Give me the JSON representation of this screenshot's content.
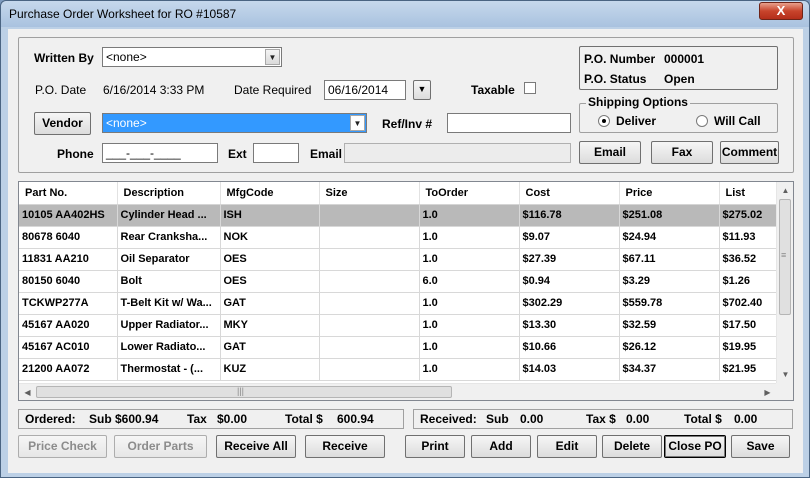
{
  "window": {
    "title": "Purchase Order Worksheet for RO #10587",
    "close_glyph": "X"
  },
  "form": {
    "written_by_label": "Written By",
    "written_by_value": "<none>",
    "po_date_label": "P.O. Date",
    "po_date_value": "6/16/2014 3:33 PM",
    "date_required_label": "Date Required",
    "date_required_value": "06/16/2014",
    "taxable_label": "Taxable",
    "vendor_button": "Vendor",
    "vendor_value": "<none>",
    "refinv_label": "Ref/Inv #",
    "refinv_value": "",
    "phone_label": "Phone",
    "phone_value": "___-___-____",
    "ext_label": "Ext",
    "ext_value": "",
    "email_label": "Email",
    "email_value": ""
  },
  "po_info": {
    "number_label": "P.O. Number",
    "number_value": "000001",
    "status_label": "P.O. Status",
    "status_value": "Open"
  },
  "shipping": {
    "title": "Shipping Options",
    "deliver_label": "Deliver",
    "willcall_label": "Will Call",
    "selected": "Deliver"
  },
  "contact_buttons": {
    "email": "Email",
    "fax": "Fax",
    "comment": "Comment"
  },
  "grid": {
    "columns": [
      "Part No.",
      "Description",
      "MfgCode",
      "Size",
      "ToOrder",
      "Cost",
      "Price",
      "List"
    ],
    "rows": [
      [
        "10105 AA402HS",
        "Cylinder Head ...",
        "ISH",
        "",
        "1.0",
        "$116.78",
        "$251.08",
        "$275.02"
      ],
      [
        "80678 6040",
        "Rear Cranksha...",
        "NOK",
        "",
        "1.0",
        "$9.07",
        "$24.94",
        "$11.93"
      ],
      [
        "11831 AA210",
        "Oil Separator",
        "OES",
        "",
        "1.0",
        "$27.39",
        "$67.11",
        "$36.52"
      ],
      [
        "80150 6040",
        "Bolt",
        "OES",
        "",
        "6.0",
        "$0.94",
        "$3.29",
        "$1.26"
      ],
      [
        "TCKWP277A",
        "T-Belt Kit w/ Wa...",
        "GAT",
        "",
        "1.0",
        "$302.29",
        "$559.78",
        "$702.40"
      ],
      [
        "45167 AA020",
        "Upper Radiator...",
        "MKY",
        "",
        "1.0",
        "$13.30",
        "$32.59",
        "$17.50"
      ],
      [
        "45167 AC010",
        "Lower Radiato...",
        "GAT",
        "",
        "1.0",
        "$10.66",
        "$26.12",
        "$19.95"
      ],
      [
        "21200 AA072",
        "Thermostat - (...",
        "KUZ",
        "",
        "1.0",
        "$14.03",
        "$34.37",
        "$21.95"
      ]
    ],
    "selected_row": 0
  },
  "ordered": {
    "label": "Ordered:",
    "sub_label": "Sub",
    "sub_value": "$600.94",
    "tax_label": "Tax",
    "tax_value": "$0.00",
    "total_label": "Total $",
    "total_value": "600.94"
  },
  "received": {
    "label": "Received:",
    "sub_label": "Sub",
    "sub_value": "0.00",
    "tax_label": "Tax $",
    "tax_value": "0.00",
    "total_label": "Total $",
    "total_value": "0.00"
  },
  "actions": {
    "price_check": "Price Check",
    "order_parts": "Order Parts",
    "receive_all": "Receive All",
    "receive": "Receive",
    "print": "Print",
    "add": "Add",
    "edit": "Edit",
    "delete": "Delete",
    "close_po": "Close PO",
    "save": "Save"
  },
  "colors": {
    "selection_blue": "#3399ff",
    "selected_row": "#b9b9b9",
    "close_red": "#c8442c"
  }
}
